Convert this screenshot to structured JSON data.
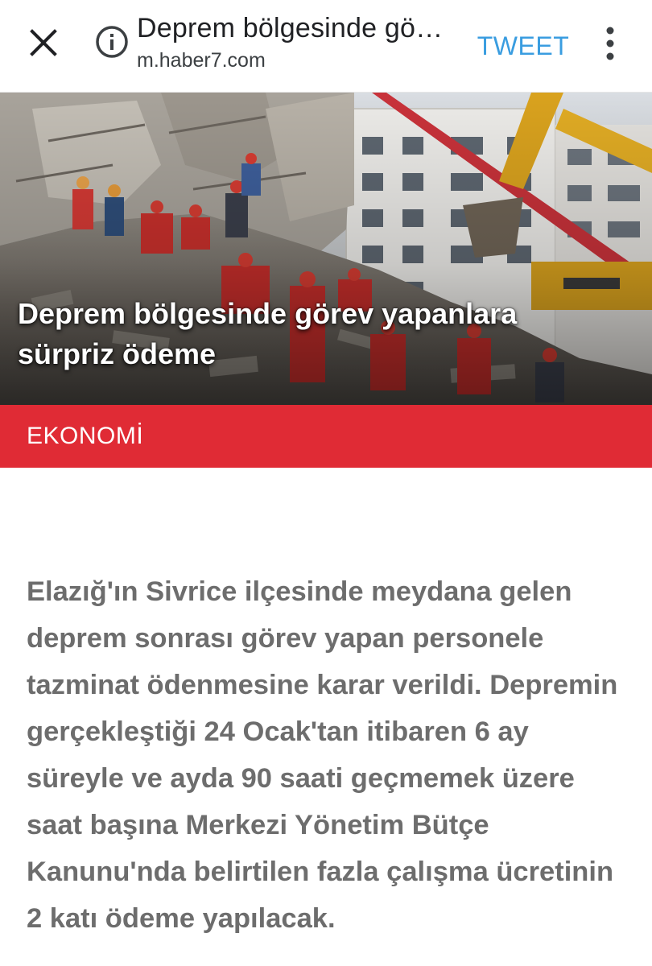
{
  "header": {
    "page_title": "Deprem bölgesinde gö…",
    "url": "m.haber7.com",
    "tweet_label": "TWEET",
    "icons": {
      "close": "close-icon",
      "info": "info-icon",
      "more": "more-vertical-icon"
    },
    "accent_color": "#3a9de0"
  },
  "hero": {
    "headline": "Deprem bölgesinde görev yapanlara sürpriz ödeme"
  },
  "category": {
    "label": "EKONOMİ",
    "color": "#e02b35"
  },
  "article": {
    "summary": "Elazığ'ın Sivrice ilçesinde meydana gelen deprem sonrası görev yapan personele tazminat ödenmesine karar verildi. Depremin gerçekleştiği 24 Ocak'tan itibaren 6 ay süreyle ve ayda 90 saati geçmemek üzere saat başına Merkezi Yönetim Bütçe Kanunu'nda belirtilen fazla çalışma ücretinin 2 katı ödeme yapılacak."
  }
}
